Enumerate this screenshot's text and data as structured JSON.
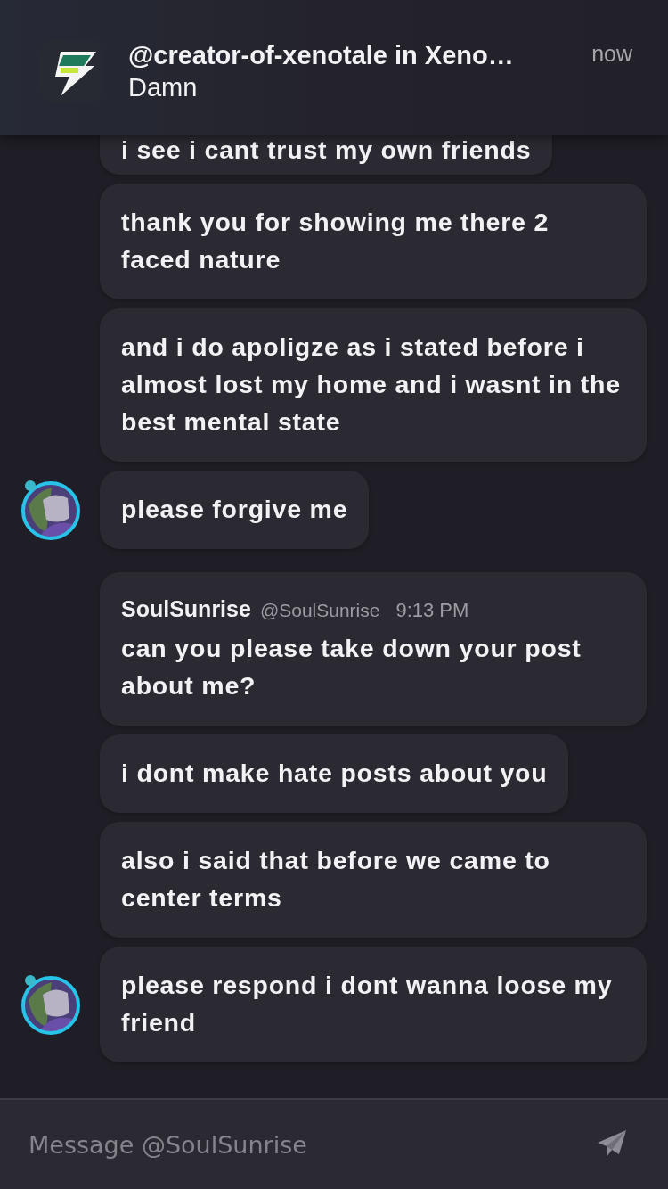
{
  "notification": {
    "title": "@creator-of-xenotale in Xeno…",
    "body": "Damn",
    "time": "now"
  },
  "messages": [
    {
      "kind": "plain",
      "avatar": false,
      "text": "i see i cant trust my own friends"
    },
    {
      "kind": "plain",
      "avatar": false,
      "text": "thank you for showing me there 2 faced nature"
    },
    {
      "kind": "plain",
      "avatar": false,
      "text": "and i do apoligze as i stated before i almost lost my home and i wasnt in the best mental state"
    },
    {
      "kind": "plain",
      "avatar": true,
      "text": "please forgive me"
    },
    {
      "kind": "header",
      "avatar": false,
      "author": "SoulSunrise",
      "handle": "@SoulSunrise",
      "time": "9:13 PM",
      "text": "can you please take down your post about me?"
    },
    {
      "kind": "plain",
      "avatar": false,
      "text": "i dont make hate posts about you"
    },
    {
      "kind": "plain",
      "avatar": false,
      "text": "also i said that before we came to center terms"
    },
    {
      "kind": "plain",
      "avatar": true,
      "text": "please respond i dont wanna loose my friend"
    }
  ],
  "composer": {
    "placeholder": "Message @SoulSunrise"
  }
}
